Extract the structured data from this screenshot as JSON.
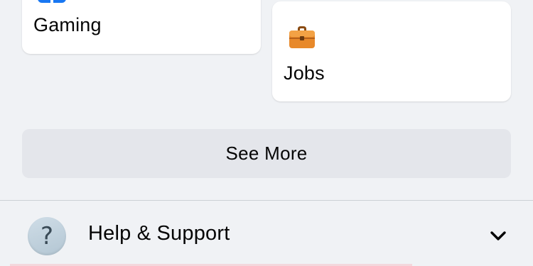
{
  "shortcuts": [
    {
      "label": "Gaming",
      "icon": "gaming-icon"
    },
    {
      "label": "Jobs",
      "icon": "briefcase-icon"
    }
  ],
  "see_more": {
    "label": "See More"
  },
  "help": {
    "label": "Help & Support",
    "icon": "help-question-icon",
    "glyph": "?",
    "expand_icon": "chevron-down-icon"
  },
  "colors": {
    "background": "#f0f2f5",
    "card": "#ffffff",
    "see_more_bg": "#e4e6eb",
    "gaming_blue": "#1877f2",
    "briefcase_orange": "#e8892a",
    "help_circle": "#c2d3de"
  }
}
